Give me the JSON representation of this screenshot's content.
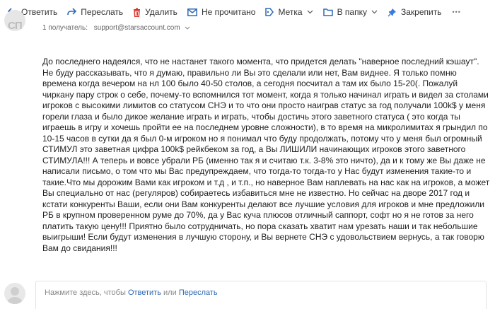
{
  "toolbar": {
    "reply": "Ответить",
    "forward": "Переслать",
    "delete": "Удалить",
    "unread": "Не прочитано",
    "label": "Метка",
    "to_folder": "В папку",
    "pin": "Закрепить",
    "more": "•••"
  },
  "meta": {
    "avatar_initials": "СП",
    "recipients_count": "1 получатель:",
    "email": "support@starsaccount.com"
  },
  "message": {
    "body": "До последнего надеялся, что не настанет такого момента, что придется делать \"наверное последний кэшаут\". Не буду рассказывать, что я думаю, правильно ли Вы это сделали или нет, Вам виднее. Я только помню времена когда вечером на нл 100 было 40-50 столов, а сегодня посчитал а там их было 15-20(. Пожалуй чиркану пару строк о себе, почему-то вспомнился тот момент, когда я только начинал играть и видел за столами игроков с высокими лимитов со статусом СНЭ и то что они просто наиграв статус за год получали 100k$ у меня горели глаза и было дикое желание играть и играть, чтобы достичь этого заветного статуса ( это когда ты играешь в игру и хочешь пройти ее на последнем уровне сложности), в то время на микролимитах я грындил по 10-15 часов в сутки да я был 0-м игроком но я понимал что буду продолжать, потому что у меня был огромный СТИМУЛ это заветная цифра 100k$ рейкбеком за год, а Вы ЛИШИЛИ начинающих игроков этого заветного СТИМУЛА!!! А теперь и вовсе убрали РБ (именно так я и считаю т.к. 3-8% это ничто), да и к тому же Вы даже не написали письмо, о том что мы Вас предупреждаем, что тогда-то тогда-то у Нас будут изменения такие-то и такие.Что мы дорожим Вами как игроком и т.д , и т.п., но наверное Вам наплевать на нас как на игроков, а может Вы специально от нас (регуляров) собираетесь избавиться мне не известно. Но сейчас на дворе 2017 год и кстати конкуренты Ваши, если они Вам конкуренты делают все лучшие условия для игроков и мне предложили РБ в крупном проверенном руме до 70%, да у Вас куча плюсов отличный саппорт, софт но я не готов за него платить такую цену!!! Приятно было сотрудничать, но пора сказать хватит нам урезать наши и так небольшие выигрыши! Если будут изменения в лучшую сторону, и Вы вернете СНЭ с удовольствием вернусь, а так говорю Вам до свидания!!!"
  },
  "reply_box": {
    "prefix": "Нажмите здесь, чтобы",
    "reply_link": "Ответить",
    "or": "или",
    "forward_link": "Переслать"
  },
  "colors": {
    "icon_blue": "#2d6ab5",
    "delete_red": "#d9322b",
    "pin_blue": "#3c7be0",
    "link_blue": "#2d6ab5"
  }
}
